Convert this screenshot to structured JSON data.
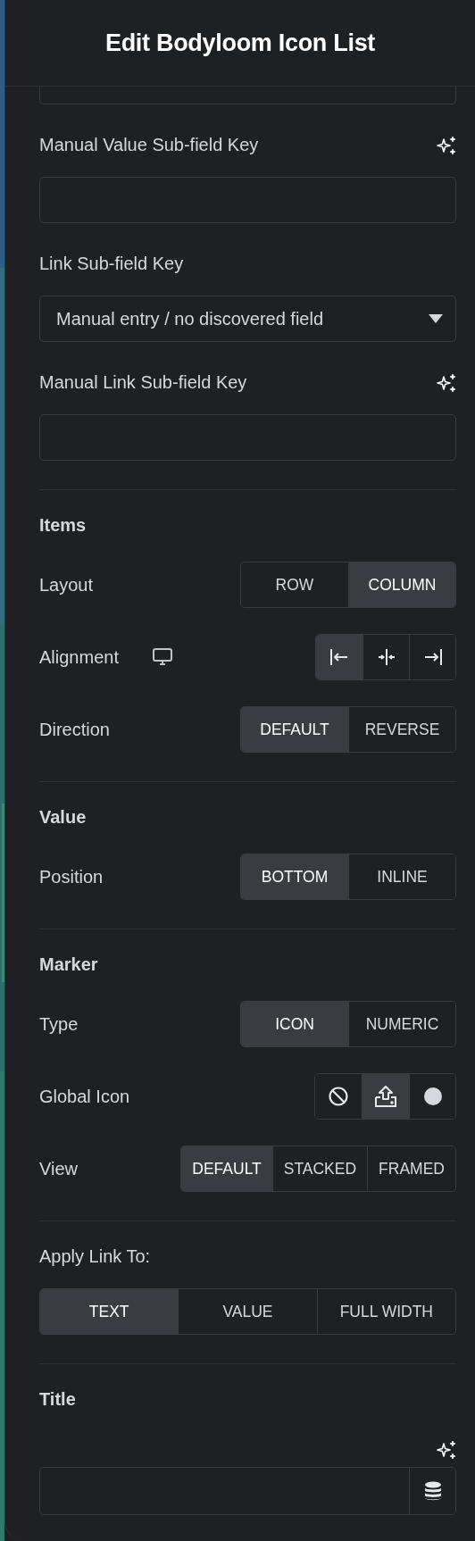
{
  "header": {
    "title": "Edit Bodyloom Icon List"
  },
  "sections": [
    {
      "controls": [
        {
          "kind": "clipped-select"
        },
        {
          "kind": "text",
          "label": "Manual Value Sub-field Key",
          "ai_button": true
        },
        {
          "kind": "select",
          "label": "Link Sub-field Key",
          "value": "Manual entry / no discovered field"
        },
        {
          "kind": "text",
          "label": "Manual Link Sub-field Key",
          "ai_button": true
        }
      ]
    },
    {
      "heading": "Items",
      "controls": [
        {
          "kind": "choice",
          "label": "Layout",
          "options": [
            {
              "label": "ROW",
              "selected": false
            },
            {
              "label": "COLUMN",
              "selected": true
            }
          ]
        },
        {
          "kind": "align-choice",
          "label": "Alignment",
          "device_icon": true,
          "options": [
            {
              "selected": true
            },
            {
              "selected": false
            },
            {
              "selected": false
            }
          ]
        },
        {
          "kind": "choice",
          "label": "Direction",
          "options": [
            {
              "label": "DEFAULT",
              "selected": true
            },
            {
              "label": "REVERSE",
              "selected": false
            }
          ]
        }
      ]
    },
    {
      "heading": "Value",
      "controls": [
        {
          "kind": "choice",
          "label": "Position",
          "options": [
            {
              "label": "BOTTOM",
              "selected": true
            },
            {
              "label": "INLINE",
              "selected": false
            }
          ]
        }
      ]
    },
    {
      "heading": "Marker",
      "controls": [
        {
          "kind": "choice",
          "label": "Type",
          "options": [
            {
              "label": "ICON",
              "selected": true
            },
            {
              "label": "NUMERIC",
              "selected": false
            }
          ]
        },
        {
          "kind": "icon-choice",
          "label": "Global Icon",
          "options": [
            {
              "selected": false
            },
            {
              "selected": true
            },
            {
              "selected": false
            }
          ]
        },
        {
          "kind": "choice",
          "label": "View",
          "options": [
            {
              "label": "DEFAULT",
              "selected": true
            },
            {
              "label": "STACKED",
              "selected": false
            },
            {
              "label": "FRAMED",
              "selected": false
            }
          ]
        }
      ]
    },
    {
      "controls": [
        {
          "kind": "block-choice",
          "label": "Apply Link To:",
          "options": [
            {
              "label": "TEXT",
              "selected": true
            },
            {
              "label": "VALUE",
              "selected": false
            },
            {
              "label": "FULL WIDTH",
              "selected": false
            }
          ]
        }
      ]
    },
    {
      "heading": "Title",
      "controls": [
        {
          "kind": "text",
          "ai_button": true,
          "dynamic_button": true
        }
      ]
    }
  ]
}
